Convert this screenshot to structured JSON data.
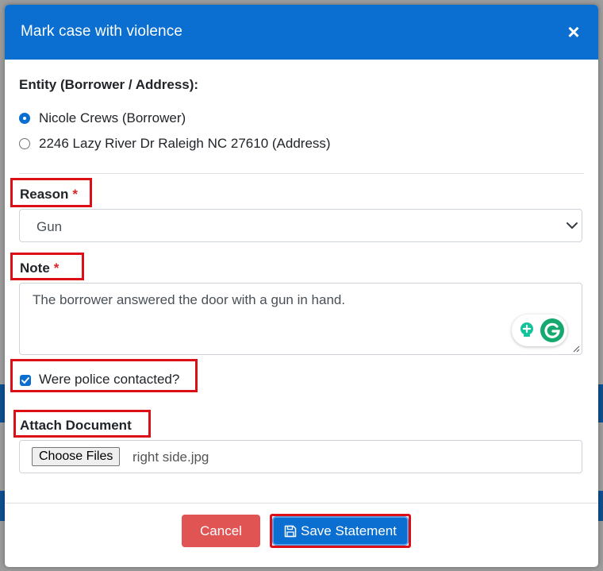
{
  "modal": {
    "title": "Mark case with violence",
    "close_label": "×"
  },
  "entity": {
    "label": "Entity (Borrower / Address):",
    "options": [
      {
        "label": "Nicole Crews (Borrower)",
        "checked": true
      },
      {
        "label": "2246 Lazy River Dr Raleigh NC 27610 (Address)",
        "checked": false
      }
    ]
  },
  "reason": {
    "label": "Reason",
    "required_mark": "*",
    "selected": "Gun"
  },
  "note": {
    "label": "Note",
    "required_mark": "*",
    "value": "The borrower answered the door with a gun in hand."
  },
  "police": {
    "label": "Were police contacted?",
    "checked": true
  },
  "attach": {
    "label": "Attach Document",
    "button_label": "Choose Files",
    "file_name": "right side.jpg"
  },
  "footer": {
    "cancel_label": "Cancel",
    "save_label": "Save Statement"
  },
  "colors": {
    "primary": "#0a6fd0",
    "danger": "#e05454",
    "highlight": "#dd0f16",
    "required": "#d9262a"
  }
}
